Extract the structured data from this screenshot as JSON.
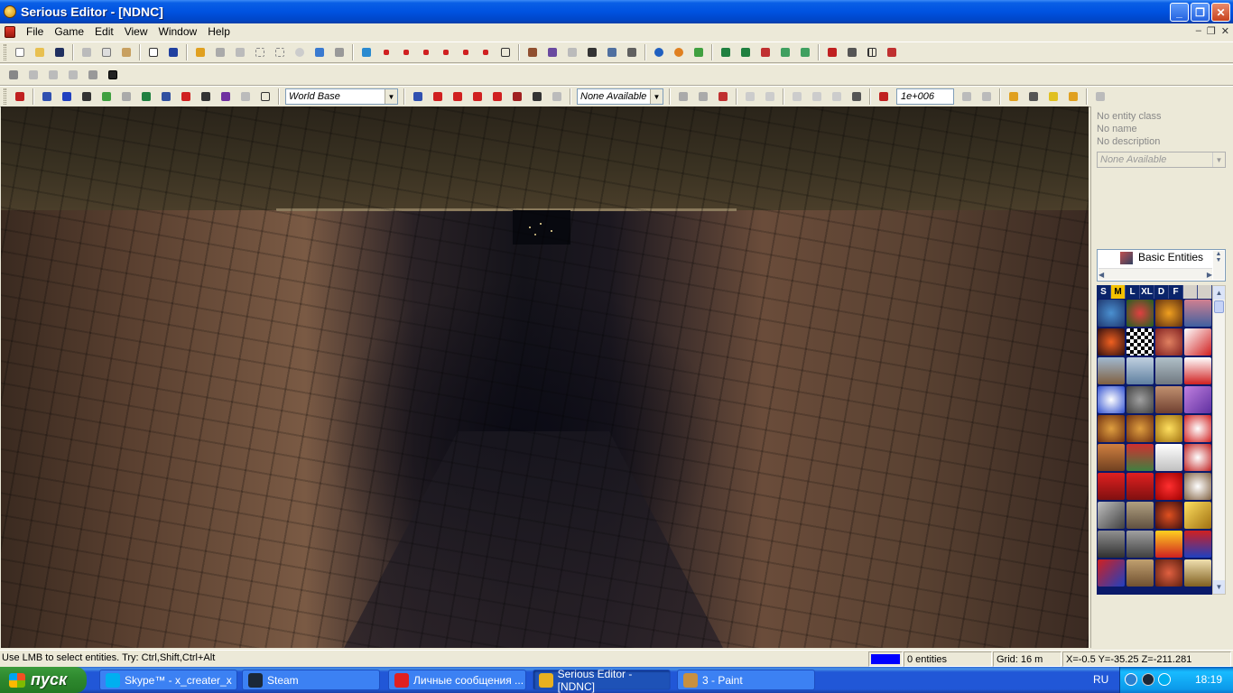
{
  "window": {
    "title": "Serious Editor - [NDNC]",
    "controls": {
      "minimize": "_",
      "maximize": "❐",
      "close": "✕"
    }
  },
  "menubar": {
    "items": [
      "File",
      "Game",
      "Edit",
      "View",
      "Window",
      "Help"
    ],
    "mdi_controls": {
      "minimize": "–",
      "restore": "❐",
      "close": "✕"
    }
  },
  "toolbar3": {
    "world_combo": "World Base",
    "entity_combo": "None Available",
    "value_box": "1e+006"
  },
  "right_panel": {
    "entity_class": "No entity class",
    "entity_name": "No name",
    "entity_description": "No description",
    "property_combo": "None Available",
    "tree_label": "Basic Entities",
    "size_tabs": [
      "S",
      "M",
      "L",
      "XL",
      "D",
      "F"
    ],
    "active_size_tab": "M"
  },
  "status": {
    "hint": "Use LMB to select entities. Try: Ctrl,Shift,Ctrl+Alt",
    "entities": "0 entities",
    "grid": "Grid: 16 m",
    "coords": "X=-0.5 Y=-35.25 Z=-211.281",
    "indicator_color": "#0000ff"
  },
  "taskbar": {
    "start_label": "пуск",
    "tasks": [
      {
        "label": "Skype™ - x_creater_x",
        "icon_color": "#00aff0"
      },
      {
        "label": "Steam",
        "icon_color": "#1b2838"
      },
      {
        "label": "Личные сообщения ...",
        "icon_color": "#e02020"
      },
      {
        "label": "Serious Editor - [NDNC]",
        "icon_color": "#e8b020"
      },
      {
        "label": "3 - Paint",
        "icon_color": "#c89040"
      }
    ],
    "language": "RU",
    "clock": "18:19"
  },
  "colors": {
    "title_blue": "#0052e0",
    "gallery_bg": "#0a1a6a",
    "active_tab": "#f5c200"
  }
}
